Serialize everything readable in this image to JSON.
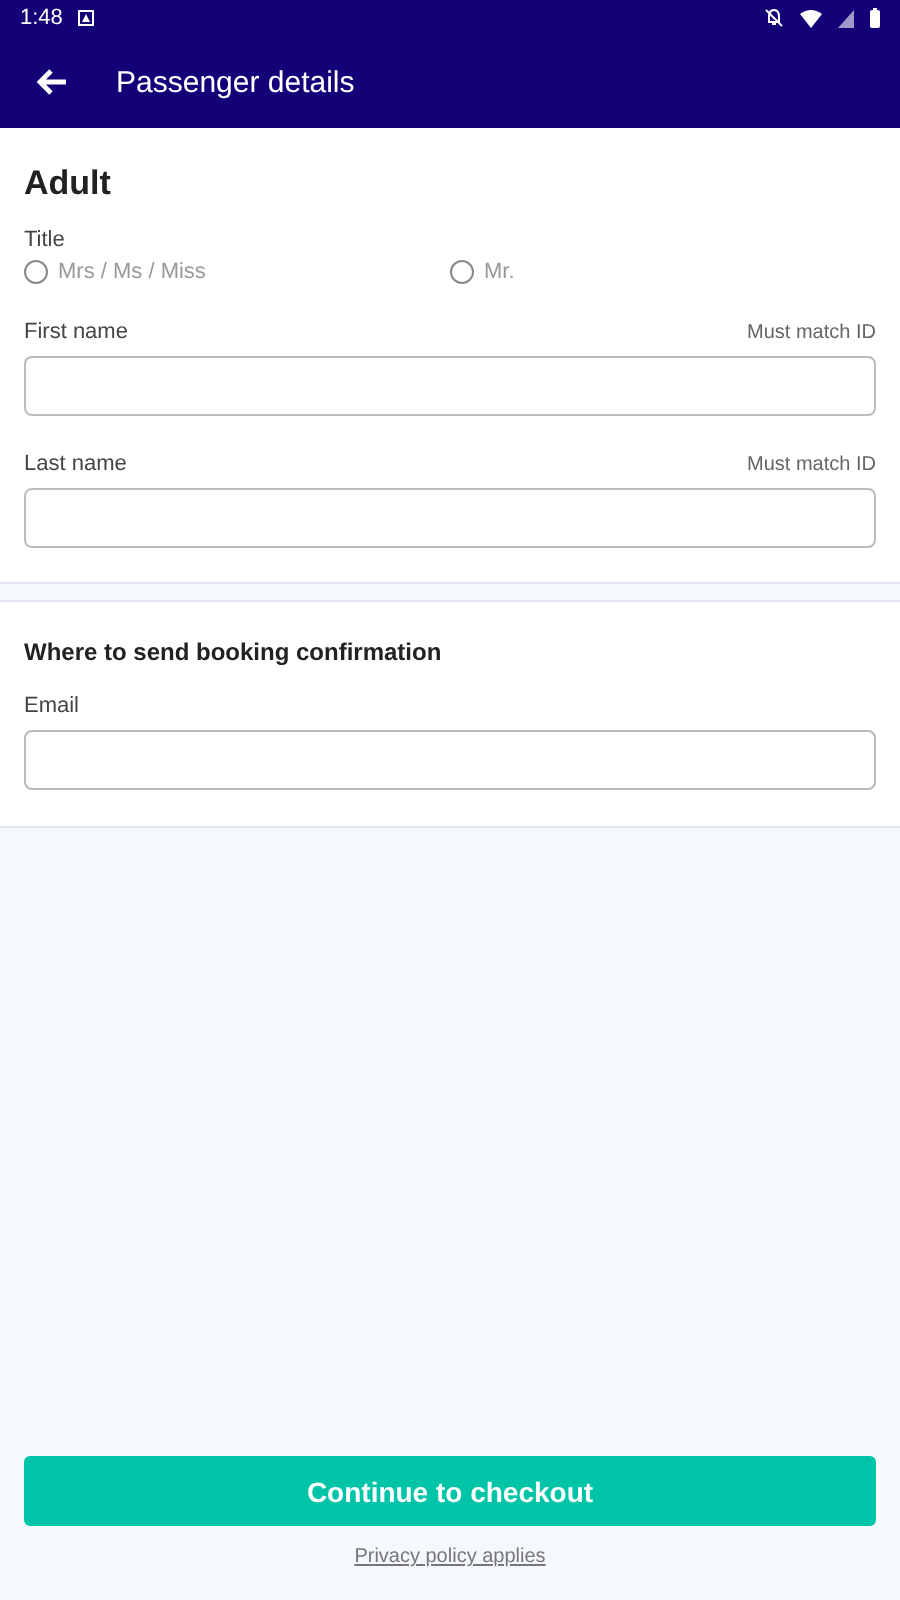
{
  "status_bar": {
    "time": "1:48"
  },
  "app_bar": {
    "title": "Passenger details"
  },
  "passenger": {
    "heading": "Adult",
    "title_label": "Title",
    "title_options": [
      {
        "label": "Mrs / Ms / Miss",
        "selected": false
      },
      {
        "label": "Mr.",
        "selected": false
      }
    ],
    "fields": [
      {
        "label": "First name",
        "hint": "Must match ID"
      },
      {
        "label": "Last name",
        "hint": "Must match ID"
      }
    ]
  },
  "confirmation": {
    "heading": "Where to send booking confirmation",
    "fields": [
      {
        "label": "Email"
      }
    ]
  },
  "continue_button": "Continue to checkout",
  "privacy_link": "Privacy policy applies"
}
